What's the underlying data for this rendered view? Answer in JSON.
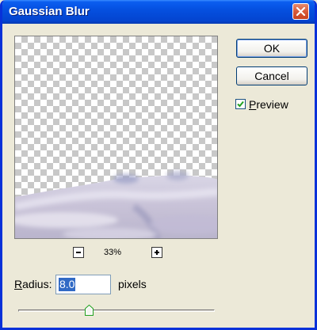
{
  "window": {
    "title": "Gaussian Blur",
    "accent_color": "#0550e0"
  },
  "buttons": {
    "ok_label": "OK",
    "cancel_label": "Cancel"
  },
  "preview_option": {
    "label": "Preview",
    "checked": true
  },
  "zoom": {
    "level": "33%",
    "minus_icon": "minus-icon",
    "plus_icon": "plus-icon"
  },
  "radius": {
    "label": "Radius:",
    "value": "8.0",
    "units": "pixels",
    "slider_fraction": 0.36
  }
}
